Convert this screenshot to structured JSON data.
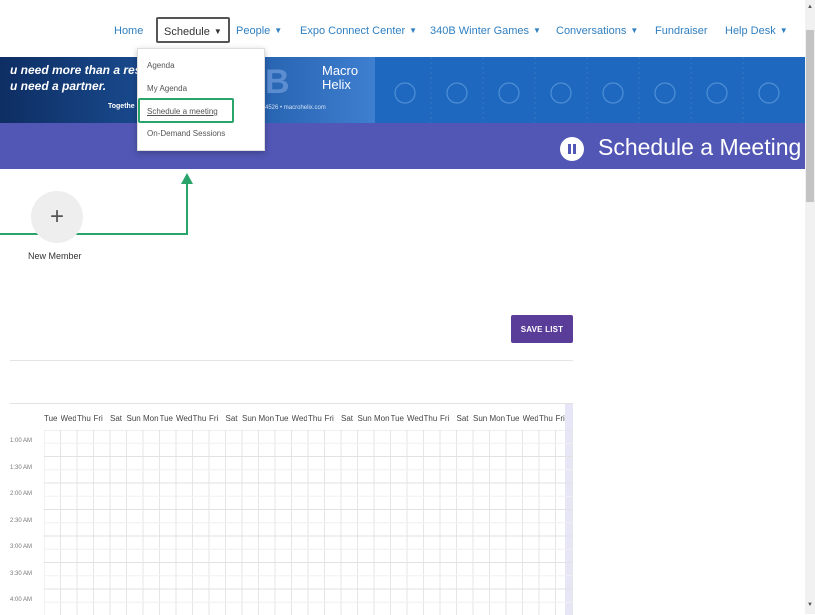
{
  "nav": {
    "items": [
      {
        "label": "Home",
        "chevron": false
      },
      {
        "label": "Schedule",
        "chevron": true,
        "active": true
      },
      {
        "label": "People",
        "chevron": true
      },
      {
        "label": "Expo Connect Center",
        "chevron": true
      },
      {
        "label": "340B Winter Games",
        "chevron": true
      },
      {
        "label": "Conversations",
        "chevron": true
      },
      {
        "label": "Fundraiser",
        "chevron": false
      },
      {
        "label": "Help Desk",
        "chevron": true
      }
    ]
  },
  "dropdown": {
    "items": [
      "Agenda",
      "My Agenda",
      "Schedule a meeting",
      "On-Demand Sessions"
    ],
    "active_index": 2
  },
  "banner": {
    "line1": "u need more than a res",
    "line2": "u need a partner.",
    "line3": "Togethe",
    "logo_line1": "Macro",
    "logo_line2": "Helix",
    "contact": "2.4526  •  macrohelix.com",
    "letter": "B"
  },
  "title": "Schedule a Meeting",
  "new_member_label": "New Member",
  "save_list_label": "SAVE LIST",
  "calendar": {
    "days": [
      "Tue",
      "Wed",
      "Thu",
      "Fri",
      "Sat",
      "Sun",
      "Mon",
      "Tue",
      "Wed",
      "Thu",
      "Fri",
      "Sat",
      "Sun",
      "Mon",
      "Tue",
      "Wed",
      "Thu",
      "Fri",
      "Sat",
      "Sun",
      "Mon",
      "Tue",
      "Wed",
      "Thu",
      "Fri",
      "Sat",
      "Sun",
      "Mon",
      "Tue",
      "Wed",
      "Thu",
      "Fri"
    ],
    "times": [
      "1:00 AM",
      "1:30 AM",
      "2:00 AM",
      "2:30 AM",
      "3:00 AM",
      "3:30 AM",
      "4:00 AM"
    ]
  },
  "colors": {
    "nav_link": "#2f7fc1",
    "title_bar": "#5257b5",
    "save_button": "#5a3d99",
    "highlight_box": "#2aa46a"
  }
}
